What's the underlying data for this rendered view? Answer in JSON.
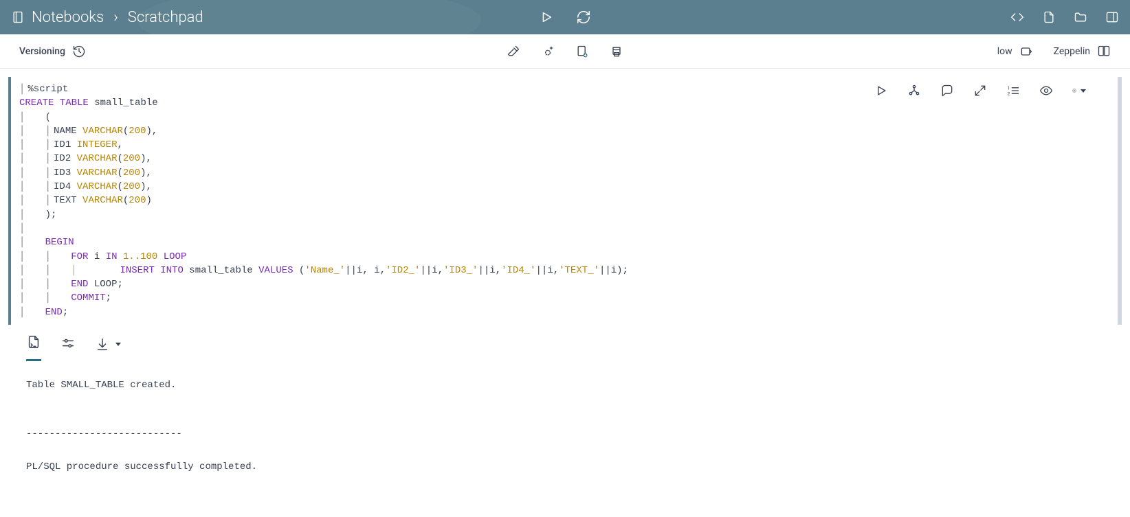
{
  "topbar": {
    "breadcrumb_root": "Notebooks",
    "breadcrumb_current": "Scratchpad"
  },
  "subbar": {
    "versioning_label": "Versioning",
    "consumer_label": "low",
    "engine_label": "Zeppelin"
  },
  "cell": {
    "script_directive": "%script",
    "code": {
      "l1_create": "CREATE TABLE",
      "l1_name": " small_table",
      "l2_open": "(",
      "col_name_lbl": "NAME",
      "col_name_type": "VARCHAR",
      "col_name_size": "200",
      "col_id1_lbl": "ID1",
      "col_id1_type": "INTEGER",
      "col_id2_lbl": "ID2",
      "col_id3_lbl": "ID3",
      "col_id4_lbl": "ID4",
      "col_text_lbl": "TEXT",
      "varchar": "VARCHAR",
      "size200": "200",
      "close": ");",
      "begin": "BEGIN",
      "for": "FOR",
      "i": "i",
      "in": "IN",
      "range": "1..100",
      "loop": "LOOP",
      "insert": "INSERT INTO",
      "table2": " small_table ",
      "values": "VALUES",
      "sp": " (",
      "s_name": "'Name_'",
      "s_id2": "'ID2_'",
      "s_id3": "'ID3_'",
      "s_id4": "'ID4_'",
      "s_text": "'TEXT_'",
      "concat": "||",
      "comma": ",",
      "endp": ");",
      "endloop": "END",
      "loop2": " LOOP;",
      "commit": "COMMIT",
      "semi": ";",
      "end": "END"
    }
  },
  "output": {
    "line1": "Table SMALL_TABLE created.",
    "sep": "---------------------------",
    "line2": "PL/SQL procedure successfully completed."
  }
}
